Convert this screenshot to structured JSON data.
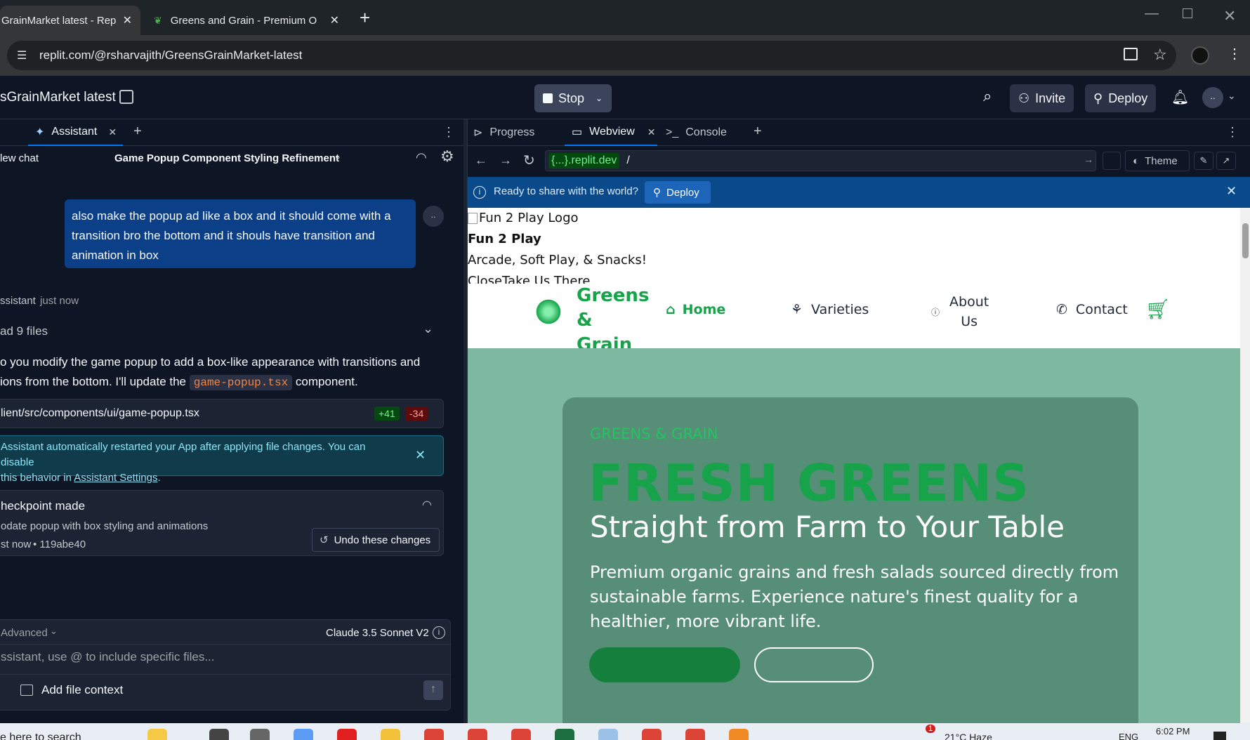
{
  "browser": {
    "tabs": [
      {
        "label": "GrainMarket latest - Rep",
        "active": true
      },
      {
        "label": "Greens and Grain - Premium O",
        "active": false
      }
    ],
    "url": "replit.com/@rsharvajith/GreensGrainMarket-latest"
  },
  "replit": {
    "project_name": "sGrainMarket latest",
    "stop_label": "Stop",
    "invite_label": "Invite",
    "deploy_label": "Deploy",
    "avatar_label": ".."
  },
  "assistant": {
    "tab_label": "Assistant",
    "new_chat": "lew chat",
    "chat_title": "Game Popup Component Styling Refinement",
    "user_message": "also make the popup ad like a box and it should come with a transition bro the bottom and it shouls have transition and animation in box",
    "user_avatar": "..",
    "sender": "ssistant",
    "time": "just now",
    "read_files": "ad 9 files",
    "reply_line1": "o you modify the game popup to add a box-like appearance with transitions and",
    "reply_line2_prefix": "ions from the bottom. I'll update the",
    "reply_code": "game-popup.tsx",
    "reply_line2_suffix": "component.",
    "file_path": "lient/src/components/ui/game-popup.tsx",
    "added": "+41",
    "removed": "-34",
    "notice_line1": "Assistant automatically restarted your App after applying file changes. You can disable",
    "notice_line2_prefix": "this behavior in",
    "notice_link": "Assistant Settings",
    "notice_line2_suffix": ".",
    "checkpoint_title": "heckpoint made",
    "checkpoint_desc": "odate popup with box styling and animations",
    "checkpoint_time": "st now",
    "checkpoint_hash": "119abe40",
    "undo_label": "Undo these changes",
    "advanced_label": "Advanced",
    "model_label": "Claude 3.5 Sonnet V2",
    "input_placeholder": "ssistant, use @ to include specific files...",
    "add_context": "Add file context"
  },
  "webview": {
    "tabs": [
      "Progress",
      "Webview",
      "Console"
    ],
    "url_host": "{...}.replit.dev",
    "url_path": "/",
    "theme_label": "Theme",
    "share_text": "Ready to share with the world?",
    "share_deploy": "Deploy",
    "popup": {
      "logo_alt": "Fun 2 Play Logo",
      "title": "Fun 2 Play",
      "subtitle": "Arcade, Soft Play, & Snacks!",
      "actions": "CloseTake Us There"
    },
    "site": {
      "brand": [
        "Greens",
        "&",
        "Grain"
      ],
      "nav": [
        "Home",
        "Varieties",
        "About Us",
        "Contact"
      ],
      "about_lines": [
        "About",
        "Us"
      ],
      "eyebrow": "GREENS & GRAIN",
      "headline": "FRESH GREENS",
      "subheadline": "Straight from Farm to Your Table",
      "body": [
        "Premium organic grains and fresh salads sourced directly from",
        "sustainable farms. Experience nature's finest quality for a",
        "healthier, more vibrant life."
      ]
    },
    "colors": {
      "brand_green": "#16a34a",
      "hero_bg": "#7fb8a0",
      "share_bar": "#0b4a8a"
    }
  },
  "taskbar": {
    "search": "e here to search",
    "weather": "21°C  Haze",
    "lang": "ENG",
    "time": "6:02 PM",
    "badge": "1"
  }
}
